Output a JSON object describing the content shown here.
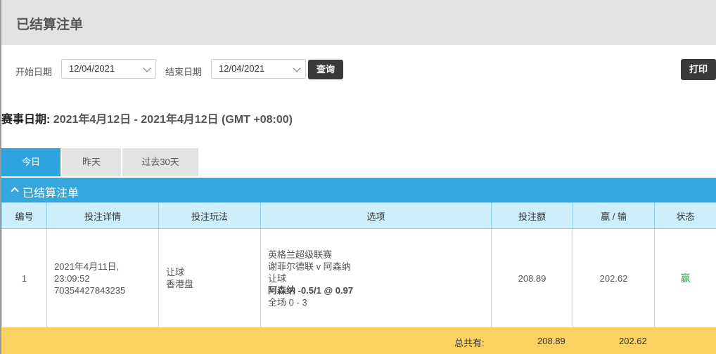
{
  "header": {
    "title": "已结算注单"
  },
  "filters": {
    "start_label": "开始日期",
    "start_value": "12/04/2021",
    "end_label": "结束日期",
    "end_value": "12/04/2021",
    "search_label": "查询",
    "print_label": "打印"
  },
  "event_date": {
    "label": "赛事日期:",
    "value": "2021年4月12日 - 2021年4月12日 (GMT +08:00)"
  },
  "tabs": [
    {
      "label": "今日",
      "active": true
    },
    {
      "label": "昨天",
      "active": false
    },
    {
      "label": "过去30天",
      "active": false
    }
  ],
  "section": {
    "title": "已结算注单"
  },
  "table": {
    "columns": [
      "编号",
      "投注详情",
      "投注玩法",
      "选项",
      "投注额",
      "赢 / 输",
      "状态"
    ],
    "rows": [
      {
        "id": "1",
        "detail_date": "2021年4月11日,",
        "detail_time": "23:09:52",
        "detail_ref": "70354427843235",
        "play_type": "让球",
        "play_odds": "香港盘",
        "option_league": "英格兰超级联赛",
        "option_match": "谢菲尔德联 v 阿森纳",
        "option_market": "让球",
        "option_pick": "阿森纳 -0.5/1 @ 0.97",
        "option_result": "全场 0 - 3",
        "stake": "208.89",
        "win_loss": "202.62",
        "status": "赢"
      }
    ]
  },
  "totals": {
    "label": "总共有:",
    "stake": "208.89",
    "win_loss": "202.62"
  },
  "colors": {
    "accent": "#35a7dc",
    "header_bg": "#e3e3e3",
    "total_bg": "#fbd261",
    "win": "#2aa84a"
  }
}
